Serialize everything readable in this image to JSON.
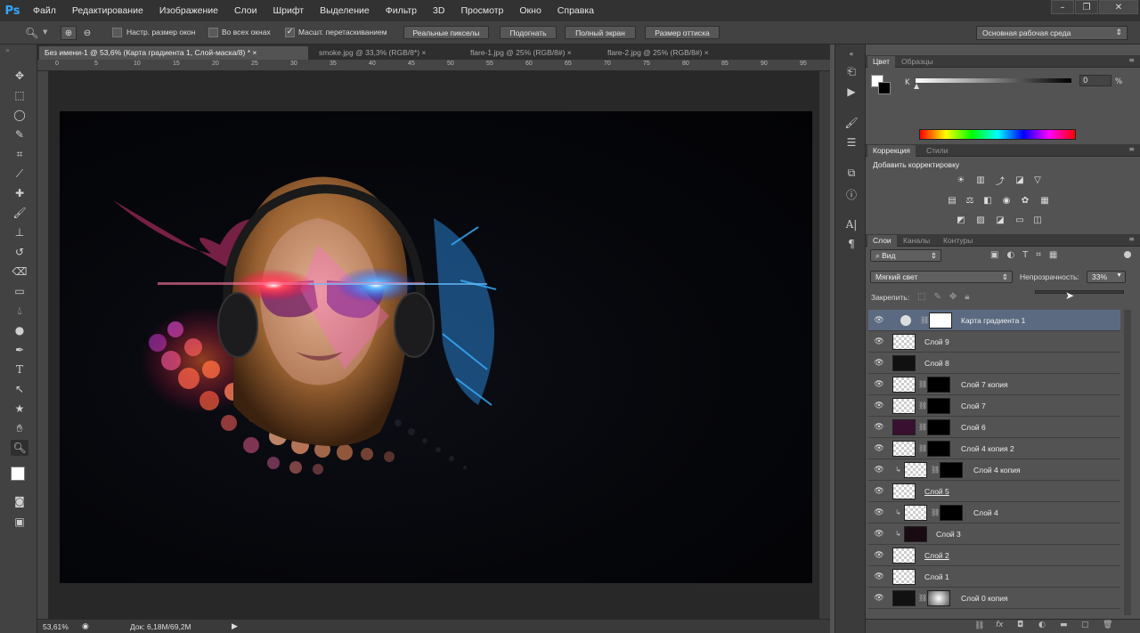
{
  "app": {
    "logo": "Ps"
  },
  "menu": [
    "Файл",
    "Редактирование",
    "Изображение",
    "Слои",
    "Шрифт",
    "Выделение",
    "Фильтр",
    "3D",
    "Просмотр",
    "Окно",
    "Справка"
  ],
  "options": {
    "checkbox1": "Настр. размер окон",
    "checkbox2": "Во всех окнах",
    "checkbox3": "Масшт. перетаскиванием",
    "btn_actual": "Реальные пикселы",
    "btn_fit": "Подогнать",
    "btn_full": "Полный экран",
    "btn_print": "Размер оттиска",
    "workspace": "Основная рабочая среда"
  },
  "tabs": [
    {
      "label": "Без имени-1 @ 53,6% (Карта градиента 1, Слой-маска/8) *",
      "close": "×"
    },
    {
      "label": "smoke.jpg @ 33,3% (RGB/8*)",
      "close": "×"
    },
    {
      "label": "flare-1.jpg @ 25% (RGB/8#)",
      "close": "×"
    },
    {
      "label": "flare-2.jpg @ 25% (RGB/8#)",
      "close": "×"
    }
  ],
  "ruler": [
    "0",
    "5",
    "10",
    "15",
    "20",
    "25",
    "30",
    "35",
    "40",
    "45",
    "50",
    "55",
    "60",
    "65",
    "70",
    "75",
    "80",
    "85",
    "90",
    "95"
  ],
  "status": {
    "zoom": "53,61%",
    "doc": "Док: 6,18M/69,2M"
  },
  "color_panel": {
    "tab1": "Цвет",
    "tab2": "Образцы",
    "k_label": "K",
    "k_value": "0",
    "k_unit": "%"
  },
  "adjust_panel": {
    "tab1": "Коррекция",
    "tab2": "Стили",
    "title": "Добавить корректировку"
  },
  "layers_panel": {
    "tab1": "Слои",
    "tab2": "Каналы",
    "tab3": "Контуры",
    "filter": "Вид",
    "blend": "Мягкий свет",
    "opacity_label": "Непрозрачность:",
    "opacity_value": "33%",
    "lock_label": "Закрепить:",
    "layers": [
      {
        "name": "Карта градиента 1"
      },
      {
        "name": "Слой 9"
      },
      {
        "name": "Слой 8"
      },
      {
        "name": "Слой 7 копия"
      },
      {
        "name": "Слой 7"
      },
      {
        "name": "Слой 6"
      },
      {
        "name": "Слой 4 копия 2"
      },
      {
        "name": "Слой 4 копия"
      },
      {
        "name": "Слой 5"
      },
      {
        "name": "Слой 4"
      },
      {
        "name": "Слой 3"
      },
      {
        "name": "Слой 2"
      },
      {
        "name": "Слой 1"
      },
      {
        "name": "Слой 0 копия"
      }
    ]
  },
  "colors": {
    "accent": "#31a8ff",
    "selected_layer": "#5b6a80"
  }
}
